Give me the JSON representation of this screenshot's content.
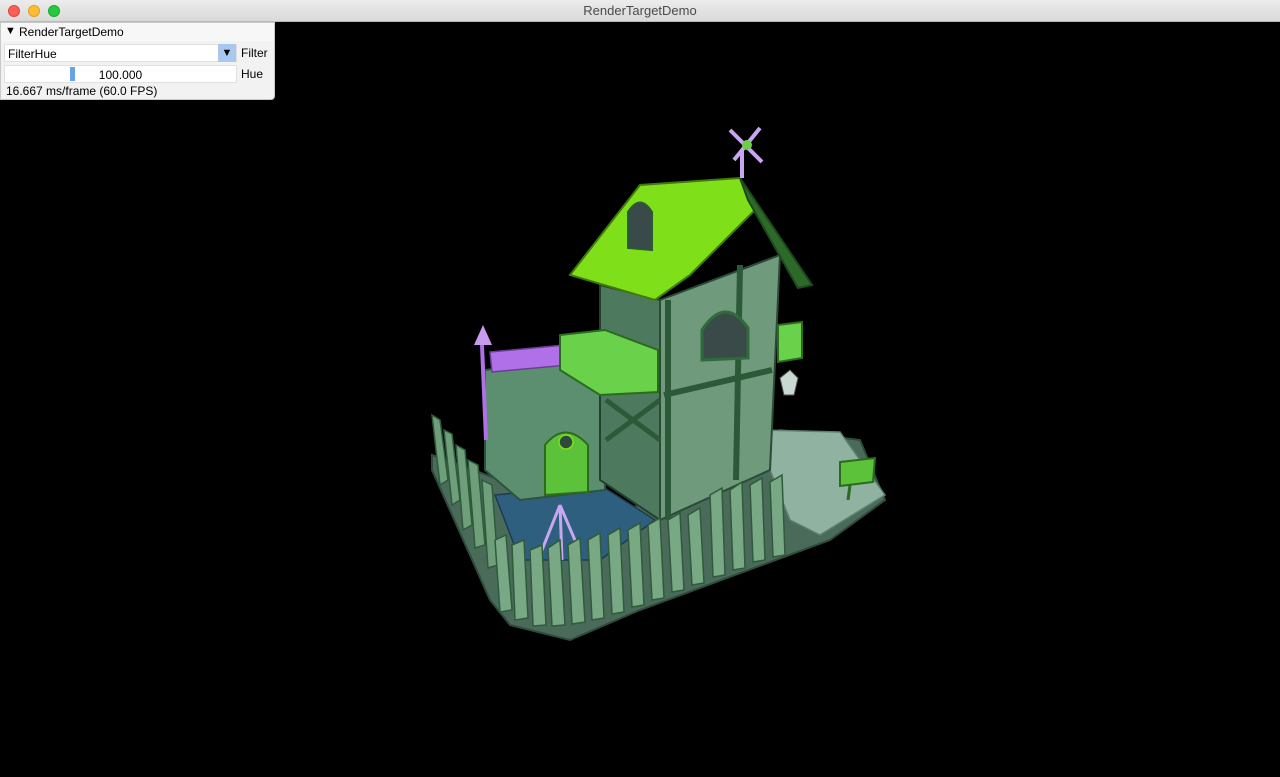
{
  "window": {
    "title": "RenderTargetDemo"
  },
  "panel": {
    "title": "RenderTargetDemo",
    "combo_value": "FilterHue",
    "combo_label": "Filter",
    "slider_value": "100.000",
    "slider_label": "Hue",
    "stats": "16.667 ms/frame (60.0 FPS)"
  },
  "scene": {
    "description_icon": "house-scene-icon"
  },
  "colors": {
    "background": "#000000",
    "roof_green": "#7fe01a",
    "wall_green": "#6f9a7c",
    "accent_purple": "#b070e8",
    "slider_blue": "#6aa2e6"
  }
}
